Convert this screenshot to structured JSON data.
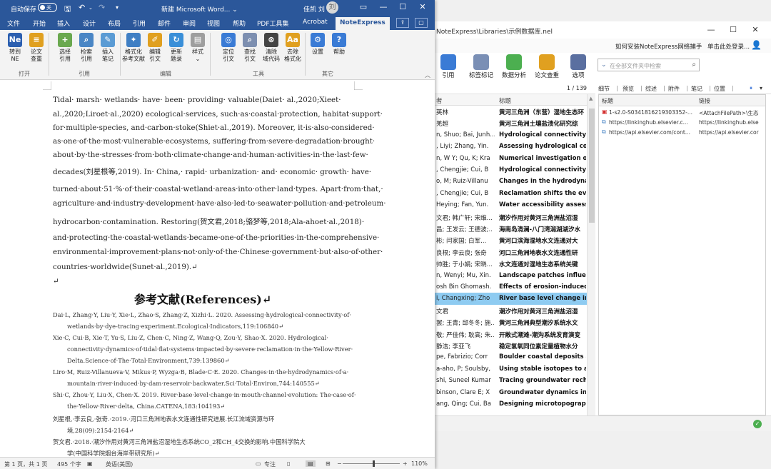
{
  "noteexpress": {
    "window_path": "NoteExpress\\Libraries\\示例数据库.nel",
    "controls": {
      "minimize": "—",
      "maximize": "☐",
      "close": "✕"
    },
    "menu": {
      "help_link": "如何安装NoteExpress网络捕手",
      "login": "单击此处登录...",
      "user_icon": "user-icon"
    },
    "toolbar": [
      {
        "label": "引用",
        "icon": "cite-icon",
        "color": "#3a7bd5"
      },
      {
        "label": "标签标记",
        "icon": "tag-icon",
        "color": "#7a8fb5"
      },
      {
        "label": "数据分析",
        "icon": "chart-icon",
        "color": "#4caf50"
      },
      {
        "label": "论文查重",
        "icon": "check-doc-icon",
        "color": "#e0a020"
      },
      {
        "label": "选项",
        "icon": "options-icon",
        "color": "#5a6fa0"
      }
    ],
    "search_placeholder": "在全部文件夹中检索",
    "record_count": "1 / 139",
    "columns": {
      "author": "者",
      "title": "标题"
    },
    "rows": [
      {
        "author": "英林",
        "title": "黄河三角洲（东营）湿地生态环"
      },
      {
        "author": "羌超",
        "title": "黄河三角洲土壤盐渍化研究综"
      },
      {
        "author": "n, Shuo; Bai, Junh...",
        "title": "Hydrological connectivity"
      },
      {
        "author": ", Liyi; Zhang, Yin.",
        "title": "Assessing hydrological cor"
      },
      {
        "author": "n, W Y; Qu, K; Kra",
        "title": "Numerical investigation on"
      },
      {
        "author": ", Chengjie; Cui, B",
        "title": "Hydrological connectivity"
      },
      {
        "author": "o, M; Ruiz-Villanu",
        "title": "Changes in the hydrodynar"
      },
      {
        "author": ", Chengjie; Cui, B",
        "title": "Reclamation shifts the evo"
      },
      {
        "author": "Heying; Fan, Yun.",
        "title": "Water accessibility assessn"
      },
      {
        "author": "文君; 韩广轩; 宋维...",
        "title": "潮汐作用对黄河三角洲盐沼湿"
      },
      {
        "author": "昌; 王发云; 王德波;..",
        "title": "海南岛清澜-八门湾潟湖湖汐水"
      },
      {
        "author": "彬; 闫家国; 白军...",
        "title": "黄河口滨海湿地水文连通对大"
      },
      {
        "author": "良根; 李云良; 张奇",
        "title": "河口三角洲地表水文连通性研"
      },
      {
        "author": "帅胜; 于小娟; 宋晓...",
        "title": "水文连通对湿地生态系统关键"
      },
      {
        "author": "n, Wenyi; Mu, Xin.",
        "title": "Landscape patches influen"
      },
      {
        "author": "osh Bin Ghomash.",
        "title": "Effects of erosion-induced"
      },
      {
        "author": "i, Changxing; Zho",
        "title": "River base level change in",
        "selected": true
      },
      {
        "author": "文君",
        "title": "潮汐作用对黄河三角洲盐沼湿"
      },
      {
        "author": "罢; 王青; 邱冬冬; 施..",
        "title": "黄河三角洲典型潮汐系统水文"
      },
      {
        "author": "敬; 严佳伟; 耿高; 朱..",
        "title": "开敞式潮滩-潮沟系统发育演变"
      },
      {
        "author": "静洁; 李亚飞",
        "title": "稳定氢氧同位素定量植物水分"
      },
      {
        "author": "pe, Fabrizio; Corr",
        "title": "Boulder coastal deposits a"
      },
      {
        "author": "a-aho, P; Soulsby,",
        "title": "Using stable isotopes to as"
      },
      {
        "author": "shi, Suneel Kumar",
        "title": "Tracing groundwater rech"
      },
      {
        "author": "binson, Clare E; X",
        "title": "Groundwater dynamics in"
      },
      {
        "author": "ang, Qing; Cui, Ba",
        "title": "Designing microtopograpl"
      }
    ],
    "detail_tabs": [
      "细节",
      "预览",
      "综述",
      "附件",
      "笔记",
      "位置"
    ],
    "attach_cols": {
      "name": "标题",
      "link": "链接"
    },
    "attachments": [
      {
        "icon": "pdf-icon",
        "name": "1-s2.0-S0341816219303352-...",
        "link": "<AttachFilePath>\\生态"
      },
      {
        "icon": "link-icon",
        "name": "https://linkinghub.elsevier.c...",
        "link": "https://linkinghub.else"
      },
      {
        "icon": "link-icon",
        "name": "https://api.elsevier.com/cont...",
        "link": "https://api.elsevier.cor"
      }
    ]
  },
  "word": {
    "autosave_label": "自动保存",
    "autosave_state": "关",
    "doc_title": "新建 Microsoft Word... ⌄",
    "user_name": "佳凯 刘",
    "user_initial": "刘",
    "controls": {
      "minimize": "—",
      "maximize": "☐",
      "close": "✕"
    },
    "tabs": [
      "文件",
      "开始",
      "插入",
      "设计",
      "布局",
      "引用",
      "邮件",
      "审阅",
      "视图",
      "帮助",
      "PDF工具集",
      "Acrobat",
      "NoteExpress"
    ],
    "active_tab": "NoteExpress",
    "ribbon_groups": [
      {
        "name": "打开",
        "buttons": [
          {
            "label": "转到\nNE",
            "icon": "ne-icon",
            "color": "#2b5fb0",
            "glyph": "Ne"
          },
          {
            "label": "论文\n查重",
            "icon": "check-doc-icon",
            "color": "#e0a020",
            "glyph": "≡"
          }
        ]
      },
      {
        "name": "引用",
        "buttons": [
          {
            "label": "选择\n引用",
            "icon": "select-cite-icon",
            "color": "#6aa84f",
            "glyph": "+"
          },
          {
            "label": "检索\n引用",
            "icon": "search-cite-icon",
            "color": "#4a86c5",
            "glyph": "⌕"
          },
          {
            "label": "插入\n笔记",
            "icon": "insert-note-icon",
            "color": "#5a9bd4",
            "glyph": "✎"
          }
        ]
      },
      {
        "name": "编辑",
        "buttons": [
          {
            "label": "格式化\n参考文献",
            "icon": "format-icon",
            "color": "#3f7fc4",
            "glyph": "✦"
          },
          {
            "label": "编辑\n引文",
            "icon": "edit-cite-icon",
            "color": "#e0a020",
            "glyph": "✐"
          },
          {
            "label": "更新\n题录",
            "icon": "refresh-icon",
            "color": "#3a8fd8",
            "glyph": "↻"
          },
          {
            "label": "样式\n⌄",
            "icon": "style-icon",
            "color": "#9e9e9e",
            "glyph": "▤"
          }
        ]
      },
      {
        "name": "工具",
        "buttons": [
          {
            "label": "定位\n引文",
            "icon": "locate-icon",
            "color": "#3a7bd5",
            "glyph": "◎"
          },
          {
            "label": "查找\n引文",
            "icon": "find-cite-icon",
            "color": "#7d8fb0",
            "glyph": "⌕"
          },
          {
            "label": "清除\n域代码",
            "icon": "clear-field-icon",
            "color": "#444444",
            "glyph": "⊗"
          },
          {
            "label": "去除\n格式化",
            "icon": "remove-format-icon",
            "color": "#e0a020",
            "glyph": "Aa"
          }
        ]
      },
      {
        "name": "其它",
        "buttons": [
          {
            "label": "设置",
            "icon": "settings-icon",
            "color": "#3a7bd5",
            "glyph": "⚙"
          },
          {
            "label": "帮助",
            "icon": "help-icon",
            "color": "#3a7bd5",
            "glyph": "?"
          }
        ]
      }
    ],
    "body_lines": [
      "Tidal· marsh· wetlands· have· been· providing· valuable(Daiet· al.,2020;Xieet·",
      "al.,2020;Liroet·al.,2020) ecological·services, such·as·coastal·protection, habitat·support·",
      "for·multiple·species, and·carbon·stoke(Shiet·al.,2019). Moreover, it·is·also·considered·",
      "as·one·of·the·most·vulnerable·ecosystems, suffering·from·severe·degradation·brought·",
      "about·by·the·stresses·from·both·climate·change·and·human·activities·in·the·last·few·",
      "decades(刘星根等,2019). In· China,· rapid· urbanization· and· economic· growth· have·",
      "turned·about·51·%·of·their·coastal·wetland·areas·into·other·land·types. Apart·from·that,·",
      "agriculture·and·industry·development·have·also·led·to·seawater·pollution·and·petroleum·",
      "hydrocarbon·contamination. Restoring(贺文君,2018;骆梦等,2018;Ala-ahoet·al.,2018)·",
      "and·protecting·the·coastal·wetlands·became·one·of·the·priorities·in·the·comprehensive·",
      "environmental·improvement·plans·not·only·of·the·Chinese·government·but·also·of·other·",
      "countries·worldwide(Sunet·al.,2019).↵",
      "↵"
    ],
    "ref_heading": "参考文献(References)↵",
    "references": [
      [
        "Dai·L, Zhang·Y, Liu·Y, Xie·L, Zhao·S, Zhang·Z, Xizhi·L. 2020. Assessing·hydrological·connectivity·of·",
        "wetlands·by·dye-tracing·experiment.Ecological·Indicators,119:106840↵"
      ],
      [
        "Xie·C, Cui·B, Xie·T, Yu·S, Liu·Z, Chen·C, Ning·Z, Wang·Q, Zou·Y, Shao·X. 2020. Hydrological·",
        "connectivity·dynamics·of·tidal·flat·systems·impacted·by·severe·reclamation·in·the·Yellow·River·",
        "Delta.Science·of·The·Total·Environment,739:139860↵"
      ],
      [
        "Liro·M, Ruiz-Villanueva·V, Mikus·P, Wyzga·B, Blade·C·E. 2020. Changes·in·the·hydrodynamics·of·a·",
        "mountain·river·induced·by·dam·reservoir·backwater.Sci·Total·Environ,744:140555↵"
      ],
      [
        "Shi·C, Zhou·Y, Liu·X, Chen·X. 2019. River·base·level·change·in·mouth·channel·evolution: The·case·of·",
        "the·Yellow·River·delta, China.CATENA,183:104193↵"
      ],
      [
        "刘星根,·李云良,·张奇.·2019.·河口三角洲地表水文连通性研究进展.长江流域资源与环",
        "境,28(09):2154-2164↵"
      ],
      [
        "贺文君.·2018.·潮汐作用对黄河三角洲盐沼湿地生态系统CO_2和CH_4交换的影响.中国科学院大",
        "学(中国科学院烟台海岸带研究所)↵"
      ]
    ],
    "status": {
      "page": "第 1 页，共 1 页",
      "words": "495 个字",
      "lang": "英语(美国)",
      "focus": "专注",
      "zoom": "110%"
    }
  }
}
